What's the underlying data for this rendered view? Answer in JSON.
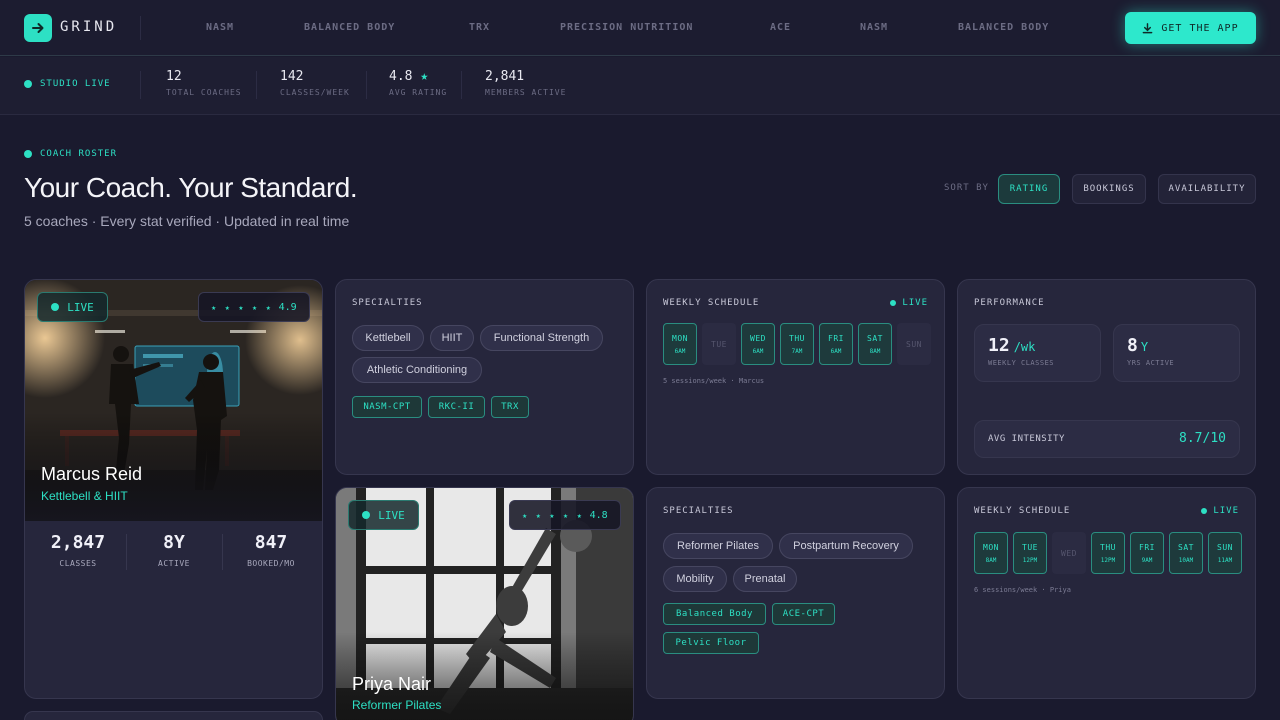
{
  "nav": {
    "logo": "GRIND",
    "partners": [
      "NASM",
      "BALANCED BODY",
      "TRX",
      "PRECISION NUTRITION",
      "ACE",
      "NASM",
      "BALANCED BODY"
    ],
    "cta": "GET THE APP"
  },
  "stats": {
    "live": "STUDIO LIVE",
    "items": [
      {
        "value": "12",
        "label": "TOTAL COACHES"
      },
      {
        "value": "142",
        "label": "CLASSES/WEEK"
      },
      {
        "value": "4.8",
        "star": "★",
        "label": "AVG RATING"
      },
      {
        "value": "2,841",
        "label": "MEMBERS ACTIVE"
      }
    ]
  },
  "roster": {
    "eyebrow": "COACH ROSTER",
    "title": "Your Coach. Your Standard.",
    "subtitle": "5 coaches · Every stat verified · Updated in real time",
    "sort_label": "SORT BY",
    "sort_options": [
      "RATING",
      "BOOKINGS",
      "AVAILABILITY"
    ]
  },
  "marcus": {
    "live": "LIVE",
    "stars": "★ ★ ★ ★ ★",
    "rating": "4.9",
    "name": "Marcus Reid",
    "specialty": "Kettlebell & HIIT",
    "stats": [
      {
        "value": "2,847",
        "label": "CLASSES"
      },
      {
        "value": "8Y",
        "label": "ACTIVE"
      },
      {
        "value": "847",
        "label": "BOOKED/MO"
      }
    ],
    "specialties_title": "SPECIALTIES",
    "specialties": [
      "Kettlebell",
      "HIIT",
      "Functional Strength",
      "Athletic Conditioning"
    ],
    "certs": [
      "NASM-CPT",
      "RKC-II",
      "TRX"
    ],
    "schedule_title": "WEEKLY SCHEDULE",
    "schedule_live": "LIVE",
    "days": [
      {
        "d": "MON",
        "t": "6AM"
      },
      {
        "d": "TUE",
        "t": ""
      },
      {
        "d": "WED",
        "t": "6AM"
      },
      {
        "d": "THU",
        "t": "7AM"
      },
      {
        "d": "FRI",
        "t": "6AM"
      },
      {
        "d": "SAT",
        "t": "8AM"
      },
      {
        "d": "SUN",
        "t": ""
      }
    ],
    "schedule_note": "5 sessions/week · Marcus",
    "perf_title": "PERFORMANCE",
    "weekly_classes": "12",
    "weekly_unit": "/wk",
    "weekly_label": "WEEKLY CLASSES",
    "years": "8",
    "years_unit": "Y",
    "years_label": "YRS ACTIVE",
    "intensity_label": "AVG INTENSITY",
    "intensity": "8.7/10"
  },
  "priya": {
    "live": "LIVE",
    "stars": "★ ★ ★ ★ ★",
    "rating": "4.8",
    "name": "Priya Nair",
    "specialty": "Reformer Pilates",
    "specialties_title": "SPECIALTIES",
    "specialties": [
      "Reformer Pilates",
      "Postpartum Recovery",
      "Mobility",
      "Prenatal"
    ],
    "certs": [
      "Balanced Body",
      "ACE-CPT",
      "Pelvic Floor"
    ],
    "schedule_title": "WEEKLY SCHEDULE",
    "schedule_live": "LIVE",
    "days": [
      {
        "d": "MON",
        "t": "8AM"
      },
      {
        "d": "TUE",
        "t": "12PM"
      },
      {
        "d": "WED",
        "t": ""
      },
      {
        "d": "THU",
        "t": "12PM"
      },
      {
        "d": "FRI",
        "t": "9AM"
      },
      {
        "d": "SAT",
        "t": "10AM"
      },
      {
        "d": "SUN",
        "t": "11AM"
      }
    ],
    "schedule_note": "6 sessions/week · Priya"
  },
  "colors": {
    "accent": "#2de0c4",
    "bg": "#1a1a2e",
    "card": "#26263c"
  }
}
